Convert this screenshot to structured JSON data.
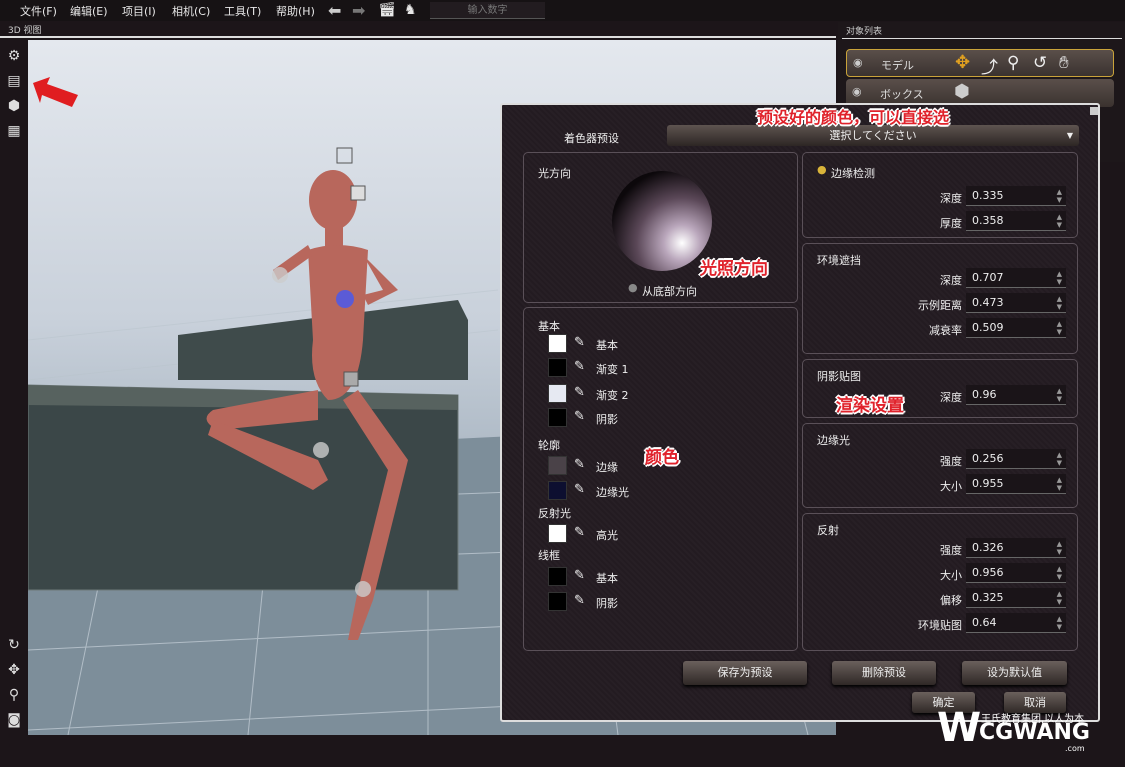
{
  "menu": [
    "文件(F)",
    "编辑(E)",
    "项目(I)",
    "相机(C)",
    "工具(T)",
    "帮助(H)"
  ],
  "toolbar_icons": [
    "arrow-left-icon",
    "arrow-right-icon",
    "clapper-icon",
    "figure-icon"
  ],
  "number_input_placeholder": "输入数字",
  "view_label": "3D 视图",
  "object_list": {
    "title": "对象列表",
    "items": [
      {
        "label": "モデル",
        "selected": true
      },
      {
        "label": "ボックス",
        "selected": false
      }
    ]
  },
  "dialog": {
    "preset_label": "着色器预设",
    "preset_value": "選択してください",
    "light": {
      "title": "光方向",
      "from_bottom": "从底部方向"
    },
    "colors": {
      "groups": [
        {
          "title": "基本",
          "rows": [
            {
              "label": "基本",
              "color": "#ffffff"
            },
            {
              "label": "渐变 1",
              "color": "#000000"
            },
            {
              "label": "渐变 2",
              "color": "#e6e9f2"
            },
            {
              "label": "阴影",
              "color": "#000000"
            }
          ]
        },
        {
          "title": "轮廓",
          "rows": [
            {
              "label": "边缘",
              "color": "#4a4248"
            },
            {
              "label": "边缘光",
              "color": "#0d0f30"
            }
          ]
        },
        {
          "title": "反射光",
          "rows": [
            {
              "label": "高光",
              "color": "#ffffff"
            }
          ]
        },
        {
          "title": "线框",
          "rows": [
            {
              "label": "基本",
              "color": "#000000"
            },
            {
              "label": "阴影",
              "color": "#000000"
            }
          ]
        }
      ]
    },
    "edge": {
      "title": "边缘检测",
      "enabled": true,
      "depth_label": "深度",
      "depth": "0.335",
      "thick_label": "厚度",
      "thick": "0.358"
    },
    "ao": {
      "title": "环境遮挡",
      "depth_label": "深度",
      "depth": "0.707",
      "dist_label": "示例距离",
      "dist": "0.473",
      "decay_label": "减衰率",
      "decay": "0.509"
    },
    "shadow": {
      "title": "阴影贴图",
      "depth_label": "深度",
      "depth": "0.96"
    },
    "rim": {
      "title": "边缘光",
      "strength_label": "强度",
      "strength": "0.256",
      "size_label": "大小",
      "size": "0.955"
    },
    "refl": {
      "title": "反射",
      "strength_label": "强度",
      "strength": "0.326",
      "size_label": "大小",
      "size": "0.956",
      "offset_label": "偏移",
      "offset": "0.325",
      "env_label": "环境贴图",
      "env": "0.64"
    },
    "buttons": {
      "save": "保存为预设",
      "delete": "删除预设",
      "default": "设为默认值",
      "ok": "确定",
      "cancel": "取消"
    }
  },
  "annotations": {
    "preset": "预设好的颜色，可以直接选",
    "light": "光照方向",
    "color": "颜色",
    "render": "渲染设置"
  },
  "watermark": {
    "slogan": "王氏教育集团,以人为本",
    "brand": "CGWANG",
    "domain": ".com"
  }
}
